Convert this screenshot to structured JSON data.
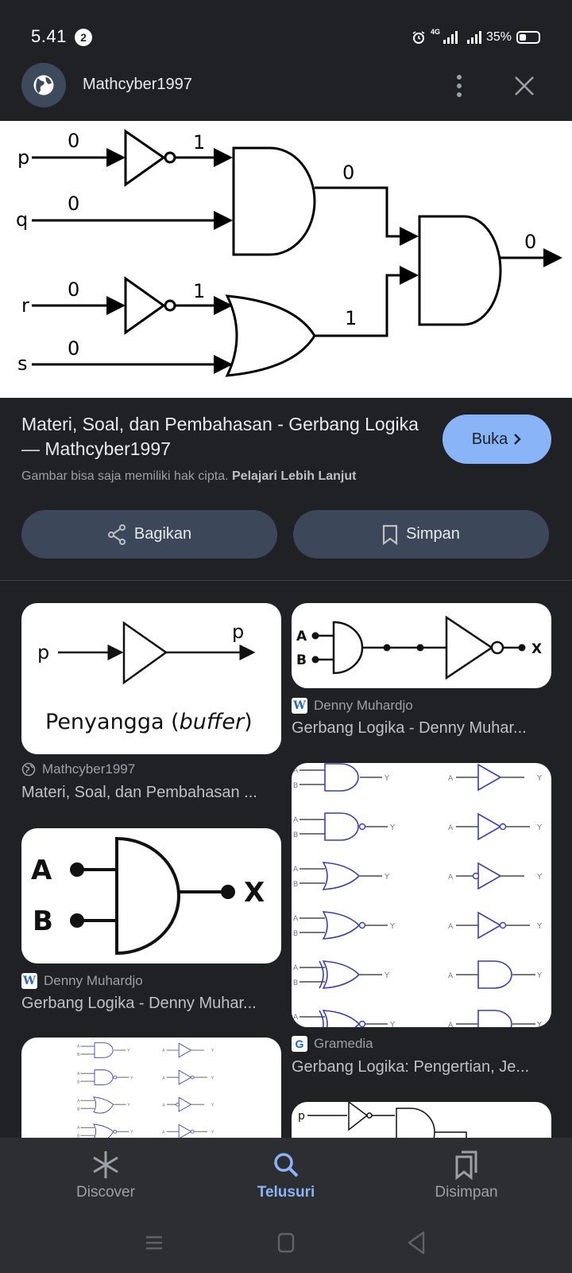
{
  "status_bar": {
    "time": "5.41",
    "notification_count": "2",
    "network": "4G",
    "battery_percent": "35%"
  },
  "app_bar": {
    "site_name": "Mathcyber1997",
    "site_icon": "globe-icon",
    "more_icon": "more-vert-icon",
    "close_icon": "close-icon"
  },
  "hero": {
    "inputs": [
      {
        "name": "p",
        "value": "0"
      },
      {
        "name": "q",
        "value": "0"
      },
      {
        "name": "r",
        "value": "0"
      },
      {
        "name": "s",
        "value": "0"
      }
    ],
    "not_p_output": "1",
    "not_r_output": "1",
    "and_output": "0",
    "or_output": "1",
    "final_output": "0"
  },
  "info": {
    "title": "Materi, Soal, dan Pembahasan - Gerbang Logika — Mathcyber1997",
    "open_label": "Buka",
    "copyright_text": "Gambar bisa saja memiliki hak cipta.",
    "learn_more": "Pelajari Lebih Lanjut",
    "share_label": "Bagikan",
    "save_label": "Simpan"
  },
  "results": [
    {
      "source": "Mathcyber1997",
      "source_icon": "globe-icon",
      "caption": "Materi, Soal, dan Pembahasan ...",
      "image_text": {
        "input": "p",
        "output": "p",
        "label_plain": "Penyangga (",
        "label_italic": "buffer",
        "label_close": ")"
      }
    },
    {
      "source": "Denny Muhardjo",
      "source_icon": "wordpress-icon",
      "caption": "Gerbang Logika - Denny Muhar...",
      "image_text": {
        "a": "A",
        "b": "B",
        "x": "X"
      }
    },
    {
      "source": "Denny Muhardjo",
      "source_icon": "wordpress-icon",
      "caption": "Gerbang Logika - Denny Muhar...",
      "image_text": {
        "a": "A",
        "b": "B",
        "x": "X"
      }
    },
    {
      "source": "Gramedia",
      "source_icon": "gramedia-icon",
      "caption": "Gerbang Logika: Pengertian, Je...",
      "image_text": {
        "a": "A",
        "b": "B",
        "y": "Y"
      }
    },
    {
      "source": "",
      "caption": "",
      "image_text": {
        "a": "A",
        "b": "B",
        "y": "Y"
      }
    },
    {
      "source": "",
      "caption": "",
      "image_text": {
        "p": "p"
      }
    }
  ],
  "bottom_nav": {
    "items": [
      {
        "label": "Discover",
        "icon": "asterisk-icon",
        "active": false
      },
      {
        "label": "Telusuri",
        "icon": "search-icon",
        "active": true
      },
      {
        "label": "Disimpan",
        "icon": "bookmarks-icon",
        "active": false
      }
    ]
  },
  "colors": {
    "background": "#202124",
    "accent": "#8ab4f8",
    "button_bg": "#3c4759",
    "nav_bg": "#2d2e31"
  }
}
